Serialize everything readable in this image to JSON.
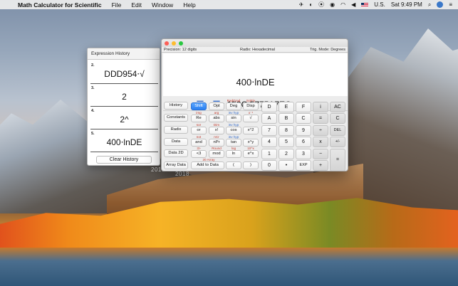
{
  "menubar": {
    "app_name": "Math Calculator for Scientific",
    "items": [
      "File",
      "Edit",
      "Window",
      "Help"
    ],
    "input_source": "U.S.",
    "clock": "Sat 9:49 PM"
  },
  "history": {
    "title": "Expression History",
    "entries": [
      {
        "num": "2.",
        "expr": "DDD954⋅√"
      },
      {
        "num": "3.",
        "expr": "2"
      },
      {
        "num": "4.",
        "expr": "2^"
      },
      {
        "num": "5.",
        "expr": "400⋅lnDE"
      }
    ],
    "clear_label": "Clear History"
  },
  "calc": {
    "precision": "Precision: 12 digits",
    "radix": "Radix: Hexadecimal",
    "trig_mode": "Trig. Mode: Degrees",
    "expression": "400⋅lnDE",
    "result": "=  159C.5775A7EC",
    "side_buttons": [
      "History",
      "Constants",
      "Radix",
      "Data",
      "Data 2D",
      "Array Data"
    ],
    "shift_label": "Shift",
    "opt_label": "Opt",
    "deg_label": "Deg",
    "disp_label": "Disp",
    "sup": {
      "deg_top": "RadGrad",
      "disp_top": "SciFix",
      "img": "img",
      "arg": "arg",
      "invhyp1": "inv hyp",
      "xinv": "x⁻¹",
      "sor": "sor",
      "mod": "Dim",
      "invhyp2": "inv hyp",
      "nxt": "not",
      "ncr": "nCr",
      "invhyp3": "inv hyp",
      "shl": "3>",
      "round": "Round",
      "log": "log",
      "pow10": "10^x",
      "arr20": "20 Array"
    },
    "fn_rows": [
      [
        "Re",
        "abs",
        "sin",
        "√"
      ],
      [
        "or",
        "x!",
        "cos",
        "x^2"
      ],
      [
        "and",
        "nPr",
        "tan",
        "x^y"
      ],
      [
        "<3",
        "mod",
        "ln",
        "e^x"
      ]
    ],
    "add_to_data": "Add to Data",
    "paren_open": "(",
    "paren_close": ")",
    "keypad": [
      [
        "D",
        "E",
        "F",
        "i",
        "AC"
      ],
      [
        "A",
        "B",
        "C",
        "=",
        "C"
      ],
      [
        "7",
        "8",
        "9",
        "÷",
        "DEL"
      ],
      [
        "4",
        "5",
        "6",
        "x",
        "+/-"
      ],
      [
        "1",
        "2",
        "3",
        "−",
        "="
      ],
      [
        "0",
        "•",
        "EXP",
        "+",
        ""
      ]
    ]
  },
  "desktop_stamp": "2018"
}
